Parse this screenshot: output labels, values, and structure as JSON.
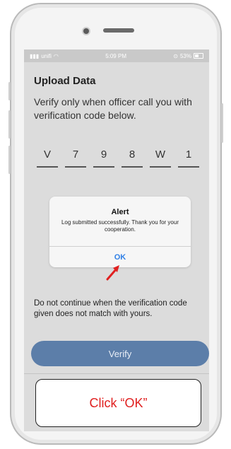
{
  "status_bar": {
    "carrier": "unifi",
    "time": "5:09 PM",
    "battery": "53%"
  },
  "page": {
    "title": "Upload Data",
    "instruction": "Verify only when officer call you with verification code below.",
    "code": [
      "V",
      "7",
      "9",
      "8",
      "W",
      "1"
    ],
    "warning": "Do not continue when the verification code given does not match with yours.",
    "verify_label": "Verify"
  },
  "alert": {
    "title": "Alert",
    "message": "Log submitted successfully. Thank you for your cooperation.",
    "ok_label": "OK"
  },
  "annotation": {
    "callout_text": "Click “OK”",
    "arrow_color": "#e02020"
  },
  "colors": {
    "verify_button": "#5c7ea9",
    "ok_text": "#2f7fe6",
    "callout_text": "#e02020"
  }
}
